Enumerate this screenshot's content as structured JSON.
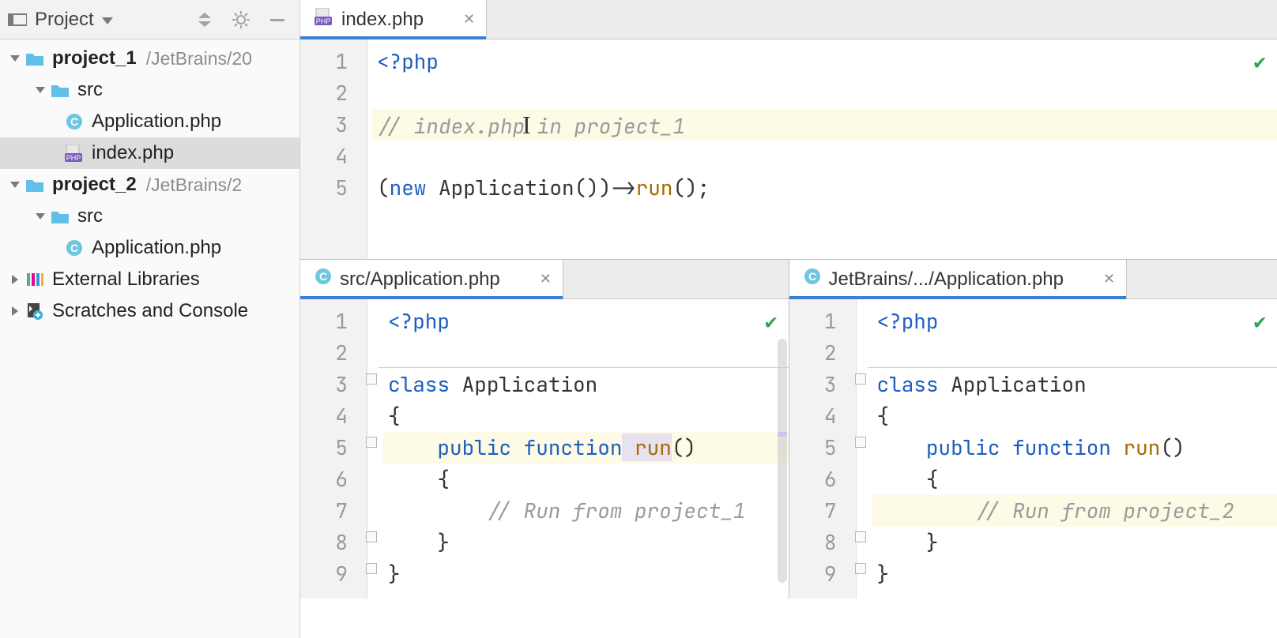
{
  "sidebar": {
    "title": "Project",
    "tree": [
      {
        "depth": 0,
        "arrow": "down",
        "icon": "folder",
        "bold": true,
        "label": "project_1",
        "hint": "/JetBrains/20",
        "selected": false
      },
      {
        "depth": 1,
        "arrow": "down",
        "icon": "folder",
        "bold": false,
        "label": "src",
        "hint": "",
        "selected": false
      },
      {
        "depth": 2,
        "arrow": "none",
        "icon": "class",
        "bold": false,
        "label": "Application.php",
        "hint": "",
        "selected": false
      },
      {
        "depth": 2,
        "arrow": "none",
        "icon": "php",
        "bold": false,
        "label": "index.php",
        "hint": "",
        "selected": true
      },
      {
        "depth": 0,
        "arrow": "down",
        "icon": "folder",
        "bold": true,
        "label": "project_2",
        "hint": "/JetBrains/2",
        "selected": false
      },
      {
        "depth": 1,
        "arrow": "down",
        "icon": "folder",
        "bold": false,
        "label": "src",
        "hint": "",
        "selected": false
      },
      {
        "depth": 2,
        "arrow": "none",
        "icon": "class",
        "bold": false,
        "label": "Application.php",
        "hint": "",
        "selected": false
      },
      {
        "depth": 0,
        "arrow": "right",
        "icon": "libs",
        "bold": false,
        "label": "External Libraries",
        "hint": "",
        "selected": false
      },
      {
        "depth": 0,
        "arrow": "right",
        "icon": "scratch",
        "bold": false,
        "label": "Scratches and Console",
        "hint": "",
        "selected": false
      }
    ]
  },
  "topEditor": {
    "tab": {
      "icon": "php",
      "label": "index.php"
    },
    "lines": [
      "1",
      "2",
      "3",
      "4",
      "5"
    ],
    "code": {
      "l1_open": "<?php",
      "l3_comment": "// index.php in project_1",
      "l5_p1": "(",
      "l5_new": "new",
      "l5_class": " Application())->",
      "l5_run": "run",
      "l5_end": "();"
    }
  },
  "leftEditor": {
    "tab": {
      "icon": "class",
      "label": "src/Application.php"
    },
    "lines": [
      "1",
      "2",
      "3",
      "4",
      "5",
      "6",
      "7",
      "8",
      "9"
    ],
    "code": {
      "open": "<?php",
      "class_kw": "class",
      "class_name": " Application",
      "brace_open": "{",
      "pub": "    public",
      "func": " function",
      "run": " run",
      "paren": "()",
      "brace2": "    {",
      "comment": "        // Run from project_1",
      "brace2c": "    }",
      "brace_c": "}"
    }
  },
  "rightEditor": {
    "tab": {
      "icon": "class",
      "label": "JetBrains/.../Application.php"
    },
    "lines": [
      "1",
      "2",
      "3",
      "4",
      "5",
      "6",
      "7",
      "8",
      "9"
    ],
    "code": {
      "open": "<?php",
      "class_kw": "class",
      "class_name": " Application",
      "brace_open": "{",
      "pub": "    public",
      "func": " function",
      "run": " run",
      "paren": "()",
      "brace2": "    {",
      "comment": "        // Run from project_2",
      "brace2c": "    }",
      "brace_c": "}"
    }
  },
  "glyphs": {
    "close": "✕",
    "check": "✔"
  }
}
